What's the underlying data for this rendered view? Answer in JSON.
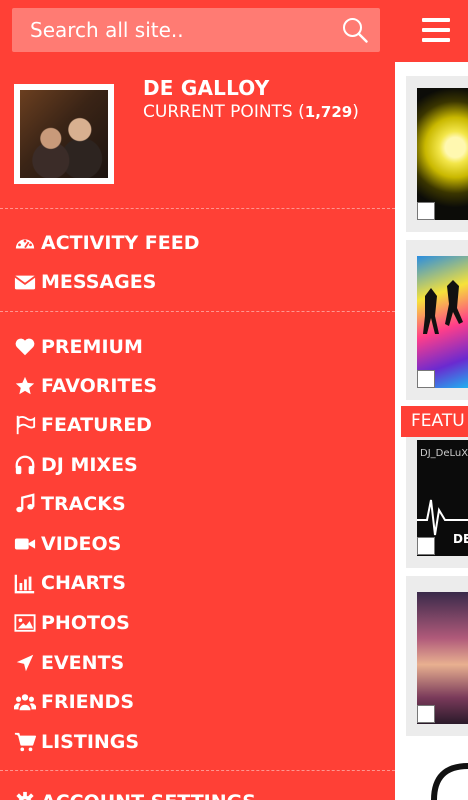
{
  "search": {
    "placeholder": "Search all site.."
  },
  "profile": {
    "name": "DE GALLOY",
    "points_label": "CURRENT POINTS (",
    "points_value": "1,729",
    "points_close": ")"
  },
  "menu_primary": [
    {
      "label": "ACTIVITY FEED",
      "icon": "dashboard-icon"
    },
    {
      "label": "MESSAGES",
      "icon": "envelope-icon"
    }
  ],
  "menu_secondary": [
    {
      "label": "PREMIUM",
      "icon": "heart-icon"
    },
    {
      "label": "FAVORITES",
      "icon": "star-icon"
    },
    {
      "label": "FEATURED",
      "icon": "flag-icon"
    },
    {
      "label": "DJ MIXES",
      "icon": "headphones-icon"
    },
    {
      "label": "TRACKS",
      "icon": "music-icon"
    },
    {
      "label": "VIDEOS",
      "icon": "video-camera-icon"
    },
    {
      "label": "CHARTS",
      "icon": "bar-chart-icon"
    },
    {
      "label": "PHOTOS",
      "icon": "image-icon"
    },
    {
      "label": "EVENTS",
      "icon": "location-arrow-icon"
    },
    {
      "label": "FRIENDS",
      "icon": "users-icon"
    },
    {
      "label": "LISTINGS",
      "icon": "shopping-cart-icon"
    }
  ],
  "menu_bottom": {
    "label": "ACCOUNT SETTINGS",
    "icon": "gear-icon"
  },
  "content": {
    "featured_tag": "FEATU",
    "card_caption": "DJ_DeLuXe",
    "card_caption_2": "DE"
  },
  "colors": {
    "brand": "#ff4036",
    "search_bg": "#ff7b73"
  }
}
